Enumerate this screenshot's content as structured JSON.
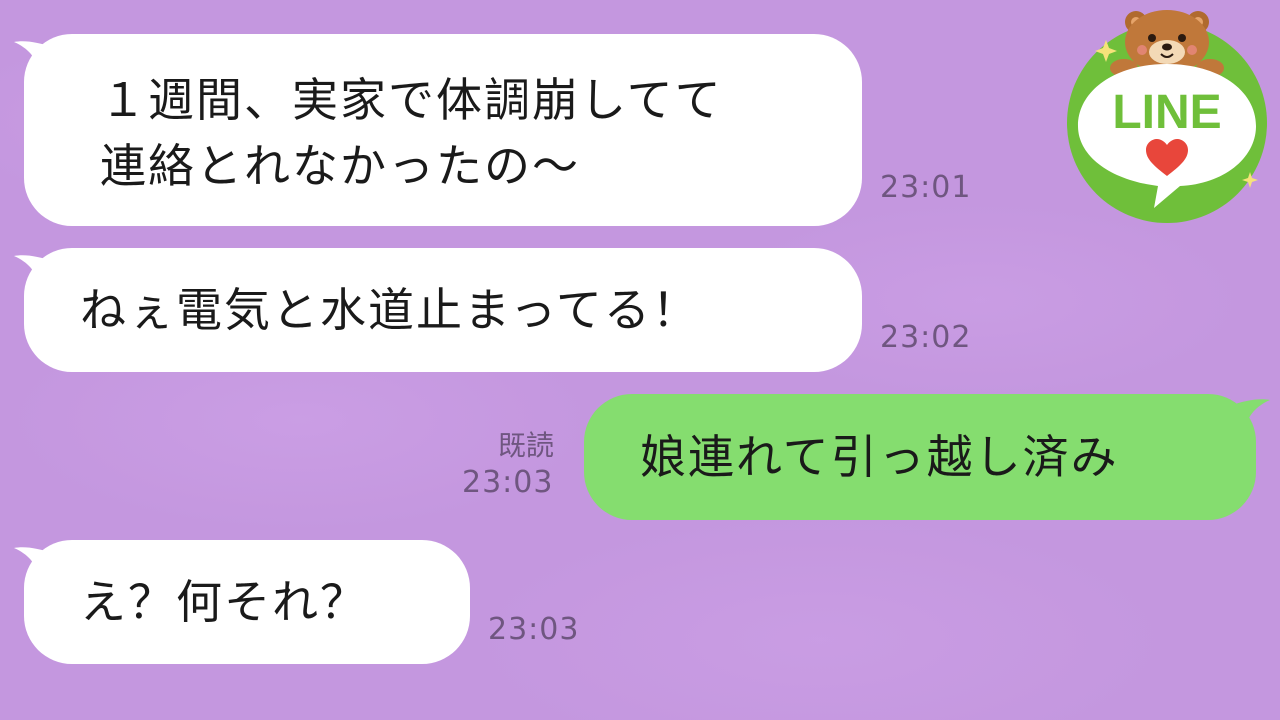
{
  "messages": [
    {
      "direction": "incoming",
      "lines": [
        "１週間、実家で体調崩してて",
        "連絡とれなかったの〜"
      ],
      "time": "23:01"
    },
    {
      "direction": "incoming",
      "lines": [
        "ねぇ電気と水道止まってる！"
      ],
      "time": "23:02"
    },
    {
      "direction": "outgoing",
      "lines": [
        "娘連れて引っ越し済み"
      ],
      "time": "23:03",
      "read_label": "既読"
    },
    {
      "direction": "incoming",
      "lines": [
        "え？何それ？"
      ],
      "time": "23:03"
    }
  ],
  "logo": {
    "text": "LINE",
    "icon": "heart-icon",
    "mascot": "bear-icon"
  },
  "colors": {
    "background": "#c497df",
    "incoming_bubble": "#ffffff",
    "outgoing_bubble": "#85dd6f",
    "timestamp": "#6f5680",
    "logo_green": "#6fbf3a"
  }
}
